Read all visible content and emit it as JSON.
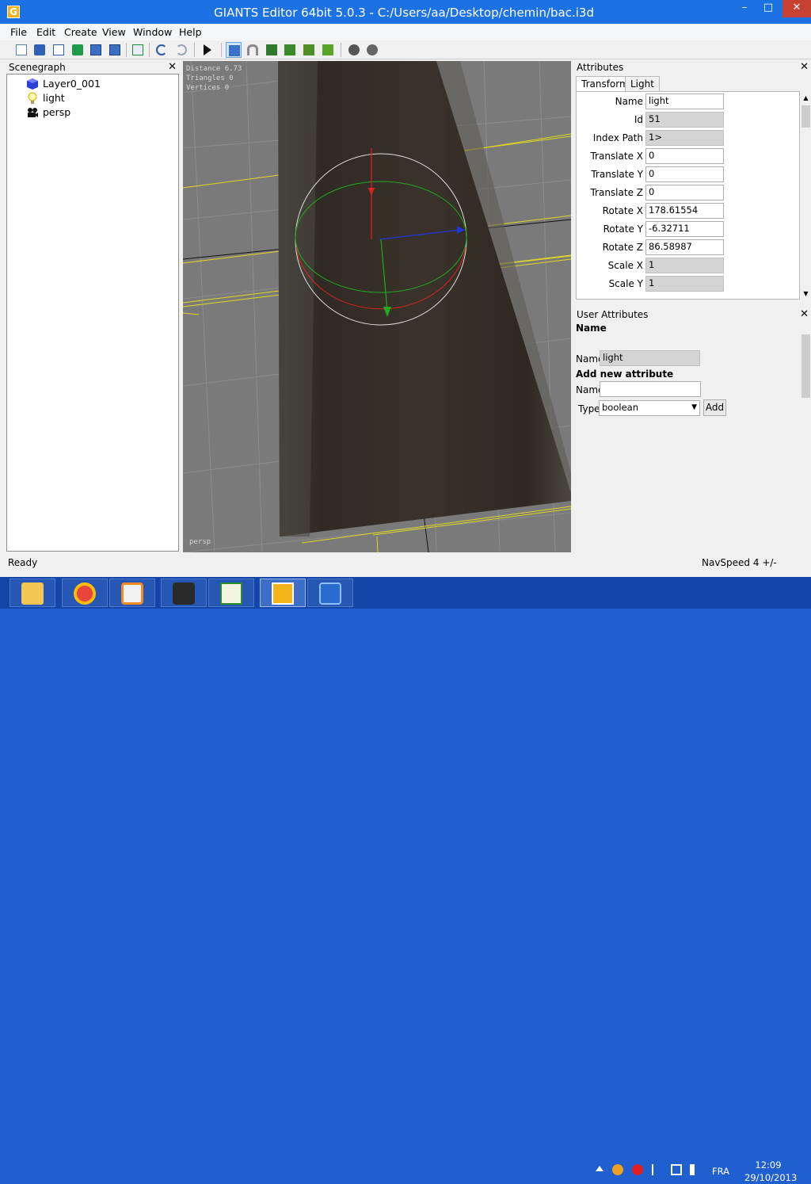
{
  "window": {
    "title": "GIANTS Editor 64bit 5.0.3 - C:/Users/aa/Desktop/chemin/bac.i3d",
    "app_icon_letter": "G",
    "min_label": "–",
    "max_label": "□",
    "close_label": "✕"
  },
  "menu": [
    "File",
    "Edit",
    "Create",
    "View",
    "Window",
    "Help"
  ],
  "scenegraph": {
    "title": "Scenegraph",
    "close": "✕",
    "items": [
      {
        "label": "Layer0_001",
        "icon": "cube-icon"
      },
      {
        "label": "light",
        "icon": "lightbulb-icon"
      },
      {
        "label": "persp",
        "icon": "camera-icon"
      }
    ]
  },
  "viewport": {
    "stats": [
      "Distance 6.73",
      "Triangles 0",
      "Vertices 0"
    ],
    "camera": "persp"
  },
  "attributes": {
    "title": "Attributes",
    "close": "✕",
    "tabs": [
      "Transform",
      "Light"
    ],
    "rows": [
      {
        "label": "Name",
        "value": "light",
        "readonly": false
      },
      {
        "label": "Id",
        "value": "51",
        "readonly": true
      },
      {
        "label": "Index Path",
        "value": "1>",
        "readonly": true
      },
      {
        "label": "Translate X",
        "value": "0",
        "readonly": false
      },
      {
        "label": "Translate Y",
        "value": "0",
        "readonly": false
      },
      {
        "label": "Translate Z",
        "value": "0",
        "readonly": false
      },
      {
        "label": "Rotate X",
        "value": "178.61554",
        "readonly": false
      },
      {
        "label": "Rotate Y",
        "value": "-6.32711",
        "readonly": false
      },
      {
        "label": "Rotate Z",
        "value": "86.58987",
        "readonly": false
      },
      {
        "label": "Scale X",
        "value": "1",
        "readonly": true
      },
      {
        "label": "Scale Y",
        "value": "1",
        "readonly": true
      }
    ]
  },
  "user_attributes": {
    "title": "User Attributes",
    "close": "✕",
    "section_name": "Name",
    "name_label": "Name",
    "name_value": "light",
    "add_new_label": "Add new attribute",
    "new_name_label": "Name",
    "new_name_value": "",
    "type_label": "Type",
    "type_value": "boolean",
    "add_button": "Add"
  },
  "status": {
    "left": "Ready",
    "right": "NavSpeed 4 +/-"
  },
  "taskbar": {
    "language": "FRA",
    "time": "12:09",
    "date": "29/10/2013"
  },
  "colors": {
    "titlebar": "#1d72e3",
    "taskbar": "#1346a8",
    "viewport_bg": "#7a7a7a",
    "gizmo_x": "#2233dd",
    "gizmo_y": "#22aa22",
    "gizmo_z": "#dd2222"
  }
}
